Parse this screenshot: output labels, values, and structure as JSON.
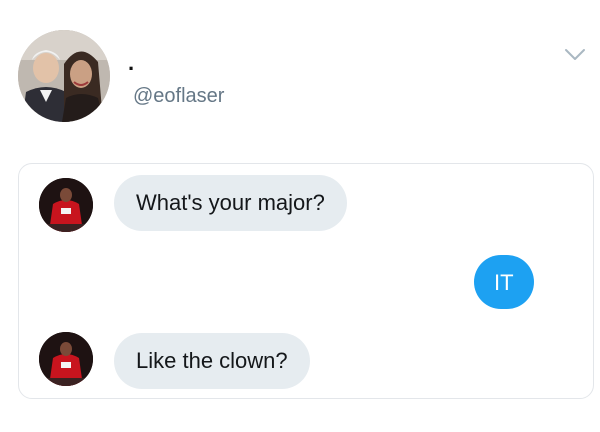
{
  "profile": {
    "display_name": ".",
    "handle": "@eoflaser"
  },
  "icons": {
    "menu": "chevron-down-icon"
  },
  "colors": {
    "incoming_bubble": "#e6ecf0",
    "outgoing_bubble": "#1da1f2",
    "handle_text": "#657786",
    "card_border": "#e3e6ea"
  },
  "conversation": {
    "messages": [
      {
        "direction": "incoming",
        "text": "What's your major?"
      },
      {
        "direction": "outgoing",
        "text": "IT"
      },
      {
        "direction": "incoming",
        "text": "Like the clown?"
      }
    ]
  }
}
